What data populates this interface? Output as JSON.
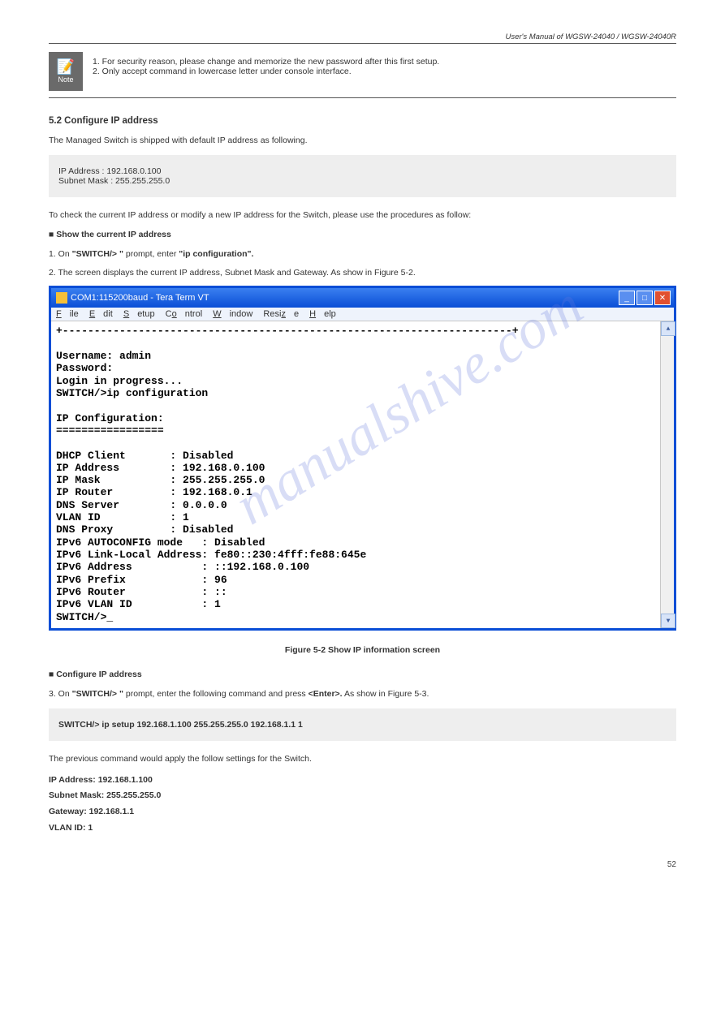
{
  "header": {
    "manual_title": "User's Manual of WGSW-24040 / WGSW-24040R"
  },
  "note": {
    "badge_label": "Note",
    "text_parts": {
      "a": "1. For security reason, please change and memorize the new password after this first setup.",
      "b": "2. Only accept command in lowercase letter under console interface."
    }
  },
  "section_ip": {
    "heading": "5.2 Configure IP address",
    "para1": "The Managed Switch is shipped with default IP address as following.",
    "defaults_line1": "IP Address : 192.168.0.100",
    "defaults_line2": "Subnet Mask : 255.255.255.0",
    "para2a": "To check the current IP address or modify a new IP address for the Switch, please use the procedures as follow:",
    "sub_a": "■ Show the current IP address",
    "step1_a": "1. On",
    "step1_b": " \"SWITCH/> \"",
    "step1_c": " prompt, enter",
    "step1_d": " \"ip configuration\".",
    "step2": "2. The screen displays the current IP address, Subnet Mask and Gateway. As show in Figure 5-2.",
    "figure_caption": "Figure 5-2 Show IP information screen"
  },
  "terminal": {
    "title": "COM1:115200baud - Tera Term VT",
    "menu": {
      "file": "File",
      "edit": "Edit",
      "setup": "Setup",
      "control": "Control",
      "window": "Window",
      "resize": "Resize",
      "help": "Help"
    },
    "content": "+-----------------------------------------------------------------------+\n\nUsername: admin\nPassword:\nLogin in progress...\nSWITCH/>ip configuration\n\nIP Configuration:\n=================\n\nDHCP Client       : Disabled\nIP Address        : 192.168.0.100\nIP Mask           : 255.255.255.0\nIP Router         : 192.168.0.1\nDNS Server        : 0.0.0.0\nVLAN ID           : 1\nDNS Proxy         : Disabled\nIPv6 AUTOCONFIG mode   : Disabled\nIPv6 Link-Local Address: fe80::230:4fff:fe88:645e\nIPv6 Address           : ::192.168.0.100\nIPv6 Prefix            : 96\nIPv6 Router            : ::\nIPv6 VLAN ID           : 1\nSWITCH/>_"
  },
  "section_set": {
    "sub_b": "■ Configure IP address",
    "step3_a": "3. On",
    "step3_b": " \"SWITCH/> \"",
    "step3_c": " prompt, enter the following command and press",
    "step3_d": " <Enter>.",
    "step3_e": " As show in Figure 5-3.",
    "cmd_line": "SWITCH/> ip setup 192.168.1.100 255.255.255.0 192.168.1.1 1",
    "para3": "The previous command would apply the follow settings for the Switch.",
    "setting1": "IP Address: 192.168.1.100",
    "setting2": "Subnet Mask: 255.255.255.0",
    "setting3": "Gateway: 192.168.1.1",
    "setting4": "VLAN ID: 1"
  },
  "footer": {
    "page_number": "52"
  },
  "watermark": "manualshive.com"
}
